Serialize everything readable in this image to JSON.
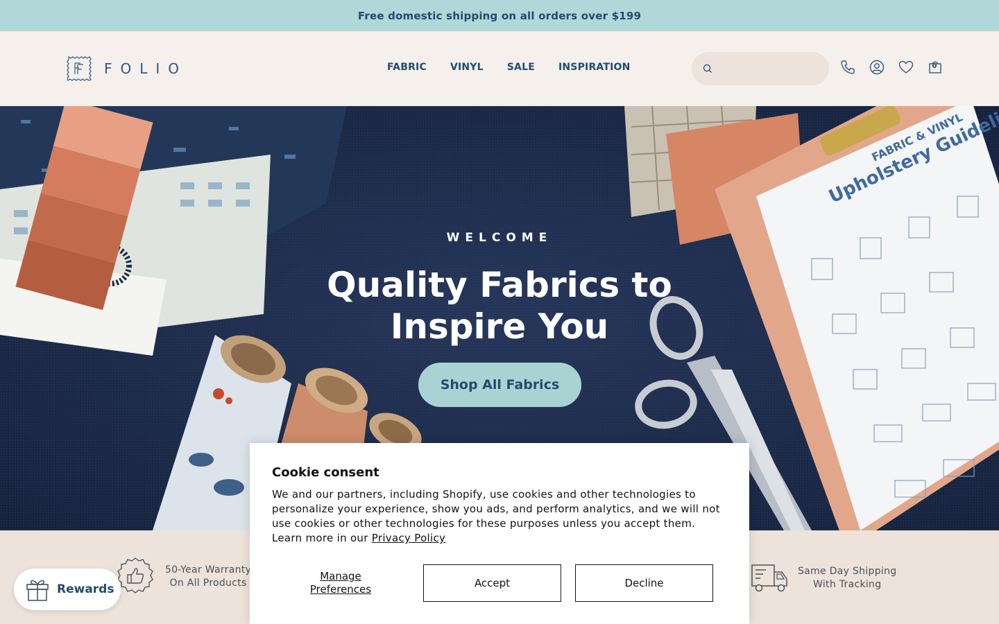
{
  "announcement": {
    "text": "Free domestic shipping on all orders over $199"
  },
  "header": {
    "logo": {
      "text": "FOLIO",
      "mark": "FF"
    },
    "nav": [
      {
        "label": "FABRIC"
      },
      {
        "label": "VINYL"
      },
      {
        "label": "SALE"
      },
      {
        "label": "INSPIRATION"
      }
    ],
    "search": {
      "placeholder": "",
      "icon": "search-icon"
    },
    "icons": [
      "phone-icon",
      "account-icon",
      "heart-icon",
      "bag-icon"
    ],
    "cart_count": "0"
  },
  "hero": {
    "eyebrow": "WELCOME",
    "title": "Quality Fabrics to Inspire You",
    "cta": "Shop All Fabrics",
    "clipboard": {
      "heading_small": "FABRIC & VINYL",
      "heading_large": "Upholstery Guidelines"
    }
  },
  "features": [
    {
      "line1": "50-Year Warranty",
      "line2": "On All Products",
      "icon": "thumbs-up-icon"
    },
    {
      "line1": "Same Day Shipping",
      "line2": "With Tracking",
      "icon": "truck-icon"
    }
  ],
  "rewards": {
    "label": "Rewards",
    "icon": "gift-icon"
  },
  "cookie": {
    "title": "Cookie consent",
    "body": "We and our partners, including Shopify, use cookies and other technologies to personalize your experience, show you ads, and perform analytics, and we will not use cookies or other technologies for these purposes unless you accept them. Learn more in our ",
    "link": "Privacy Policy",
    "manage_line1": "Manage",
    "manage_line2": "Preferences",
    "accept": "Accept",
    "decline": "Decline"
  },
  "colors": {
    "announcement_bg": "#b0d8d8",
    "header_bg": "#f5f0ec",
    "brand_navy": "#234b6e",
    "hero_bg": "#1c2a48",
    "cta_bg": "#a9d3d3",
    "features_bg": "#eee3da"
  }
}
